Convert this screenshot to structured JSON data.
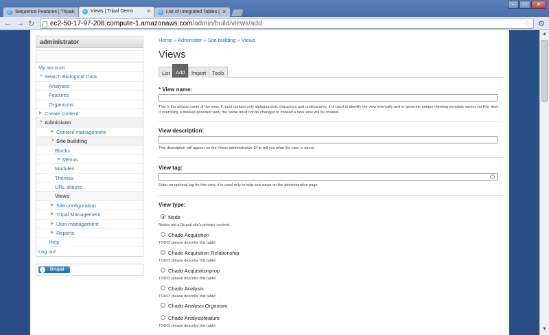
{
  "browser": {
    "tabs": [
      {
        "title": "Sequence Features | Tripal"
      },
      {
        "title": "Views | Tripal Demo"
      },
      {
        "title": "List of Integrated Tables |"
      }
    ],
    "url_host": "ec2-50-17-97-208.compute-1.amazonaws.com",
    "url_path": "/admin/build/views/add"
  },
  "sidebar": {
    "title": "administrator",
    "items": [
      {
        "label": "My account"
      },
      {
        "label": "Search Biological Data"
      },
      {
        "label": "Analyses"
      },
      {
        "label": "Features"
      },
      {
        "label": "Organisms"
      },
      {
        "label": "Create content"
      },
      {
        "label": "Administer"
      },
      {
        "label": "Content management"
      },
      {
        "label": "Site building"
      },
      {
        "label": "Blocks"
      },
      {
        "label": "Menus"
      },
      {
        "label": "Modules"
      },
      {
        "label": "Themes"
      },
      {
        "label": "URL aliases"
      },
      {
        "label": "Views"
      },
      {
        "label": "Site configuration"
      },
      {
        "label": "Tripal Management"
      },
      {
        "label": "User management"
      },
      {
        "label": "Reports"
      },
      {
        "label": "Help"
      },
      {
        "label": "Log out"
      }
    ],
    "badge": "Drupal"
  },
  "breadcrumb": [
    "Home",
    "Administer",
    "Site building",
    "Views"
  ],
  "breadcrumb_sep": "»",
  "page_title": "Views",
  "local_tabs": [
    "List",
    "Add",
    "Import",
    "Tools"
  ],
  "form": {
    "required_mark": "*",
    "view_name_label": "View name:",
    "view_name_value": "",
    "view_name_help": "This is the unique name of the view. It must contain only alphanumeric characters and underscores; it is used to identify the view internally and to generate unique theming template names for this view. If overriding a module provided view, the name must not be changed or instead a new view will be created.",
    "view_description_label": "View description:",
    "view_description_value": "",
    "view_description_help": "This description will appear on the Views administrative UI to tell you what the view is about.",
    "view_tag_label": "View tag:",
    "view_tag_value": "",
    "view_tag_help": "Enter an optional tag for this view; it is used only to help sort views on the administrative page.",
    "view_type_label": "View type:",
    "view_types": [
      {
        "label": "Node",
        "desc": "Nodes are a Drupal site's primary content.",
        "selected": true
      },
      {
        "label": "Chado Acquisition",
        "desc": "TODO: please describe this table!",
        "selected": false
      },
      {
        "label": "Chado Acquisition Relationship",
        "desc": "TODO: please describe this table!",
        "selected": false
      },
      {
        "label": "Chado Acquisitionprop",
        "desc": "TODO: please describe this table!",
        "selected": false
      },
      {
        "label": "Chado Analysis",
        "desc": "TODO: please describe this table!",
        "selected": false
      },
      {
        "label": "Chado Analysis Organism",
        "desc": "",
        "selected": false
      },
      {
        "label": "Chado Analysisfeature",
        "desc": "TODO: please describe this table!",
        "selected": false
      }
    ]
  }
}
